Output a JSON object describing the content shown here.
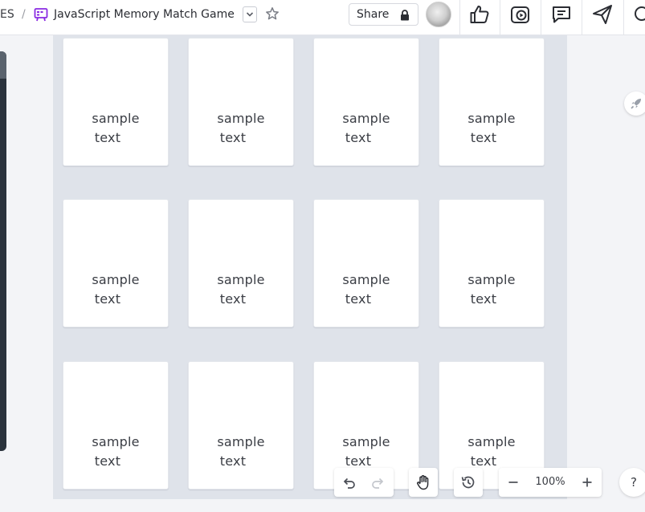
{
  "header": {
    "breadcrumb_prefix": "ES",
    "breadcrumb_separator": "/",
    "doc_title": "JavaScript Memory Match Game",
    "share_label": "Share",
    "brand_icon_color": "#8a2be2"
  },
  "toolbar_icons": [
    "thumbs-up-icon",
    "present-icon",
    "comment-icon",
    "send-icon",
    "search-icon"
  ],
  "cards": [
    {
      "line1": "sample",
      "line2": "text"
    },
    {
      "line1": "sample",
      "line2": "text"
    },
    {
      "line1": "sample",
      "line2": "text"
    },
    {
      "line1": "sample",
      "line2": "text"
    },
    {
      "line1": "sample",
      "line2": "text"
    },
    {
      "line1": "sample",
      "line2": "text"
    },
    {
      "line1": "sample",
      "line2": "text"
    },
    {
      "line1": "sample",
      "line2": "text"
    },
    {
      "line1": "sample",
      "line2": "text"
    },
    {
      "line1": "sample",
      "line2": "text"
    },
    {
      "line1": "sample",
      "line2": "text"
    },
    {
      "line1": "sample",
      "line2": "text"
    }
  ],
  "bottom_toolbar": {
    "zoom_level": "100%",
    "help_label": "?"
  }
}
